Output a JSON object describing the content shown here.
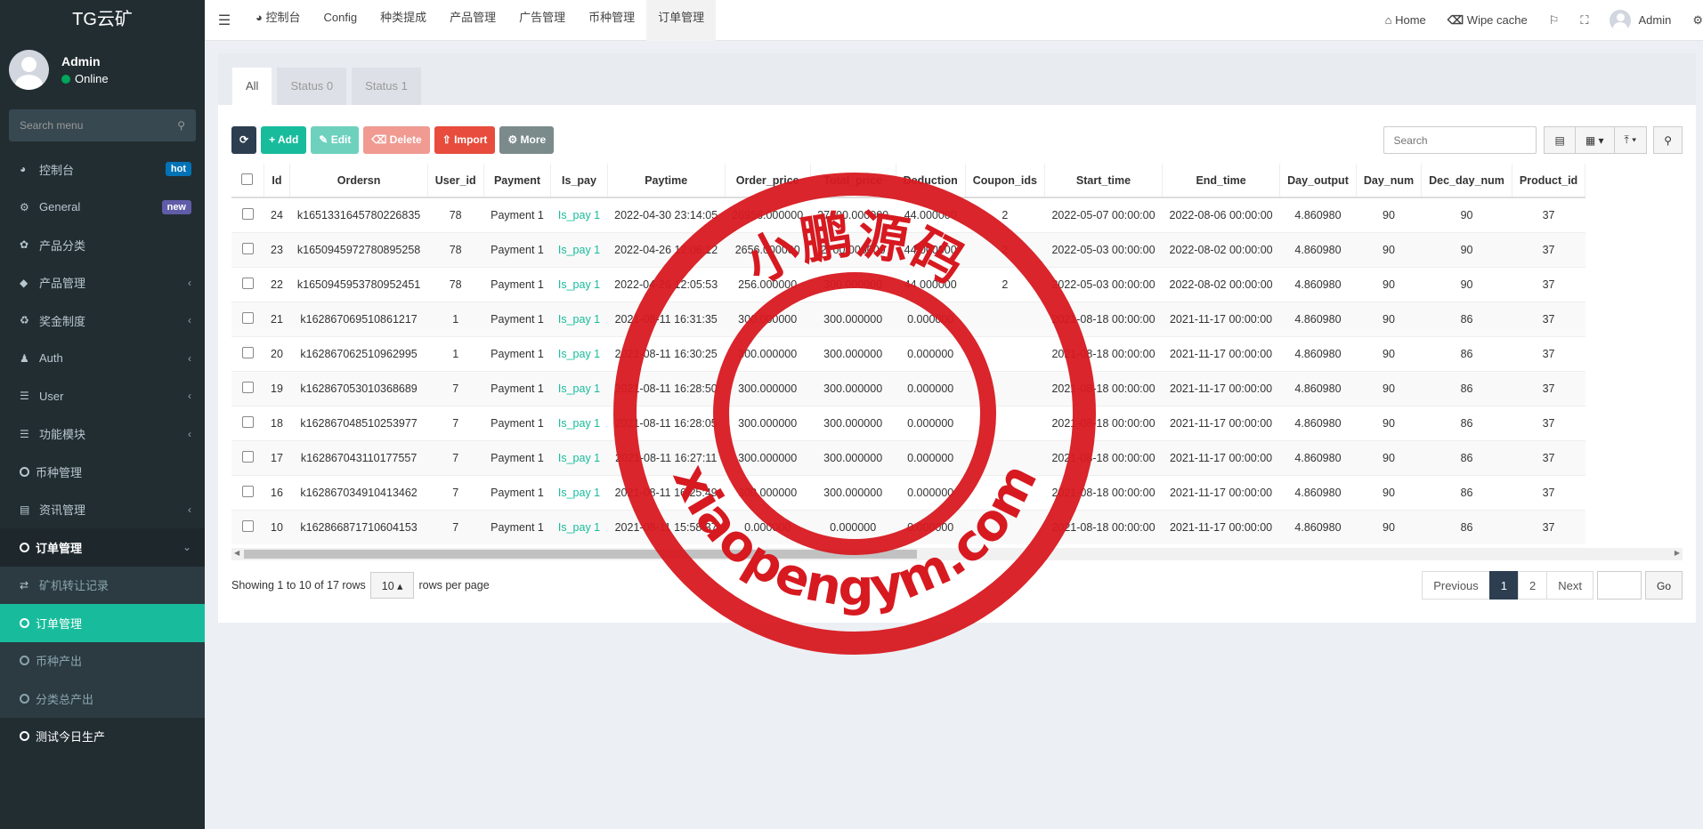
{
  "sidebar": {
    "logo": "TG云矿",
    "user": {
      "name": "Admin",
      "status": "Online"
    },
    "search_placeholder": "Search menu",
    "items": [
      {
        "label": "控制台",
        "badge": "hot"
      },
      {
        "label": "General",
        "badge": "new"
      },
      {
        "label": "产品分类"
      },
      {
        "label": "产品管理"
      },
      {
        "label": "奖金制度"
      },
      {
        "label": "Auth"
      },
      {
        "label": "User"
      },
      {
        "label": "功能模块"
      },
      {
        "label": "币种管理"
      },
      {
        "label": "资讯管理"
      },
      {
        "label": "订单管理"
      }
    ],
    "sub_items": [
      {
        "label": "矿机转让记录"
      },
      {
        "label": "订单管理"
      },
      {
        "label": "币种产出"
      },
      {
        "label": "分类总产出"
      }
    ],
    "last_item": "测试今日生产"
  },
  "topnav": {
    "tabs": [
      "控制台",
      "Config",
      "种类提成",
      "产品管理",
      "广告管理",
      "币种管理",
      "订单管理"
    ],
    "home": "Home",
    "wipe": "Wipe cache",
    "admin": "Admin"
  },
  "content_tabs": [
    "All",
    "Status 0",
    "Status 1"
  ],
  "toolbar": {
    "add": "Add",
    "edit": "Edit",
    "delete": "Delete",
    "import": "Import",
    "more": "More",
    "search_placeholder": "Search"
  },
  "table": {
    "columns": [
      "Id",
      "Ordersn",
      "User_id",
      "Payment",
      "Is_pay",
      "Paytime",
      "Order_price",
      "Total_price",
      "Deduction",
      "Coupon_ids",
      "Start_time",
      "End_time",
      "Day_output",
      "Day_num",
      "Dec_day_num",
      "Product_id"
    ],
    "rows": [
      [
        "24",
        "k1651331645780226835",
        "78",
        "Payment 1",
        "Is_pay 1",
        "2022-04-30 23:14:05",
        "26956.000000",
        "27000.000000",
        "44.000000",
        "2",
        "2022-05-07 00:00:00",
        "2022-08-06 00:00:00",
        "4.860980",
        "90",
        "90",
        "37"
      ],
      [
        "23",
        "k1650945972780895258",
        "78",
        "Payment 1",
        "Is_pay 1",
        "2022-04-26 12:06:12",
        "2656.000000",
        "2700.000000",
        "44.000000",
        "2",
        "2022-05-03 00:00:00",
        "2022-08-02 00:00:00",
        "4.860980",
        "90",
        "90",
        "37"
      ],
      [
        "22",
        "k1650945953780952451",
        "78",
        "Payment 1",
        "Is_pay 1",
        "2022-04-26 12:05:53",
        "256.000000",
        "300.000000",
        "44.000000",
        "2",
        "2022-05-03 00:00:00",
        "2022-08-02 00:00:00",
        "4.860980",
        "90",
        "90",
        "37"
      ],
      [
        "21",
        "k162867069510861217",
        "1",
        "Payment 1",
        "Is_pay 1",
        "2021-08-11 16:31:35",
        "300.000000",
        "300.000000",
        "0.000000",
        "",
        "2021-08-18 00:00:00",
        "2021-11-17 00:00:00",
        "4.860980",
        "90",
        "86",
        "37"
      ],
      [
        "20",
        "k162867062510962995",
        "1",
        "Payment 1",
        "Is_pay 1",
        "2021-08-11 16:30:25",
        "300.000000",
        "300.000000",
        "0.000000",
        "",
        "2021-08-18 00:00:00",
        "2021-11-17 00:00:00",
        "4.860980",
        "90",
        "86",
        "37"
      ],
      [
        "19",
        "k162867053010368689",
        "7",
        "Payment 1",
        "Is_pay 1",
        "2021-08-11 16:28:50",
        "300.000000",
        "300.000000",
        "0.000000",
        "",
        "2021-08-18 00:00:00",
        "2021-11-17 00:00:00",
        "4.860980",
        "90",
        "86",
        "37"
      ],
      [
        "18",
        "k162867048510253977",
        "7",
        "Payment 1",
        "Is_pay 1",
        "2021-08-11 16:28:05",
        "300.000000",
        "300.000000",
        "0.000000",
        "",
        "2021-08-18 00:00:00",
        "2021-11-17 00:00:00",
        "4.860980",
        "90",
        "86",
        "37"
      ],
      [
        "17",
        "k162867043110177557",
        "7",
        "Payment 1",
        "Is_pay 1",
        "2021-08-11 16:27:11",
        "300.000000",
        "300.000000",
        "0.000000",
        "",
        "2021-08-18 00:00:00",
        "2021-11-17 00:00:00",
        "4.860980",
        "90",
        "86",
        "37"
      ],
      [
        "16",
        "k162867034910413462",
        "7",
        "Payment 1",
        "Is_pay 1",
        "2021-08-11 16:25:49",
        "300.000000",
        "300.000000",
        "0.000000",
        "",
        "2021-08-18 00:00:00",
        "2021-11-17 00:00:00",
        "4.860980",
        "90",
        "86",
        "37"
      ],
      [
        "10",
        "k162866871710604153",
        "7",
        "Payment 1",
        "Is_pay 1",
        "2021-08-11 15:58:37",
        "0.000000",
        "0.000000",
        "0.000000",
        "",
        "2021-08-18 00:00:00",
        "2021-11-17 00:00:00",
        "4.860980",
        "90",
        "86",
        "37"
      ]
    ]
  },
  "pagination": {
    "showing": "Showing 1 to 10 of 17 rows",
    "page_size": "10",
    "rows_per_page": "rows per page",
    "previous": "Previous",
    "pages": [
      "1",
      "2"
    ],
    "next": "Next",
    "go": "Go"
  },
  "watermark": {
    "top": "小鹏源码",
    "bottom": "xiaopengym.com",
    "color": "#d71920"
  }
}
